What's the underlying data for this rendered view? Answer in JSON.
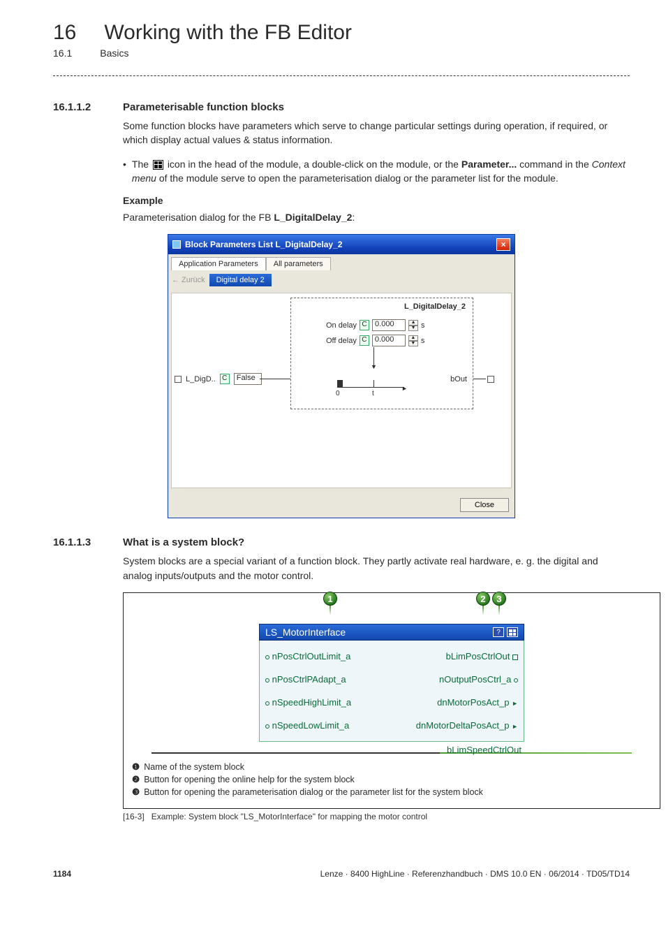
{
  "chapter": {
    "num": "16",
    "title": "Working with the FB Editor"
  },
  "subchapter": {
    "num": "16.1",
    "title": "Basics"
  },
  "sec1": {
    "num": "16.1.1.2",
    "title": "Parameterisable function blocks",
    "p1": "Some function blocks have parameters which serve to change particular settings during operation, if required, or which display actual values & status information.",
    "bullet_pre": "The ",
    "bullet_mid": " icon in the head of the module, a double-click on the module, or the ",
    "bullet_param_label": "Parameter...",
    "bullet_post1": " command in the ",
    "bullet_ctx": "Context menu",
    "bullet_post2": " of the module serve to open the parameterisation dialog or the parameter list for the module.",
    "example_h": "Example",
    "p2_pre": "Parameterisation dialog for the FB ",
    "p2_fb": "L_DigitalDelay_2",
    "p2_post": ":"
  },
  "dialog": {
    "title": "Block Parameters List L_DigitalDelay_2",
    "tab1": "Application Parameters",
    "tab2": "All parameters",
    "back": "Zurück",
    "crumb": "Digital delay 2",
    "fb_title": "L_DigitalDelay_2",
    "on_label": "On delay",
    "off_label": "Off delay",
    "on_val": "0.000",
    "off_val": "0.000",
    "unit": "s",
    "c": "C",
    "ldig": "L_DigD..",
    "ldig_val": "False",
    "out": "bOut",
    "zero": "0",
    "t": "t",
    "close": "Close"
  },
  "sec2": {
    "num": "16.1.1.3",
    "title": "What is a system block?",
    "p1": "System blocks are a special variant of a function block. They partly activate real hardware, e. g. the digital and analog inputs/outputs and the motor control."
  },
  "sb": {
    "head": "LS_MotorInterface",
    "help": "?",
    "rows": [
      {
        "l": "nPosCtrlOutLimit_a",
        "r": "bLimPosCtrlOut",
        "rt": "box"
      },
      {
        "l": "nPosCtrlPAdapt_a",
        "r": "nOutputPosCtrl_a",
        "rt": "dot"
      },
      {
        "l": "nSpeedHighLimit_a",
        "r": "dnMotorPosAct_p",
        "rt": "arrow"
      },
      {
        "l": "nSpeedLowLimit_a",
        "r": "dnMotorDeltaPosAct_p",
        "rt": "arrow"
      }
    ],
    "trailing": "bLimSpeedCtrlOut"
  },
  "callouts": {
    "c1": "1",
    "c2": "2",
    "c3": "3"
  },
  "legend": {
    "l1_sym": "❶",
    "l1_txt": "Name of the system block",
    "l2_sym": "❷",
    "l2_txt": "Button for opening the online help for the system block",
    "l3_sym": "❸",
    "l3_txt": "Button for opening the parameterisation dialog or the parameter list for the system block"
  },
  "caption": {
    "num": "[16-3]",
    "txt": "Example: System block \"LS_MotorInterface\" for mapping the motor control"
  },
  "footer": {
    "page": "1184",
    "meta": "Lenze · 8400 HighLine · Referenzhandbuch · DMS 10.0 EN · 06/2014 · TD05/TD14"
  }
}
